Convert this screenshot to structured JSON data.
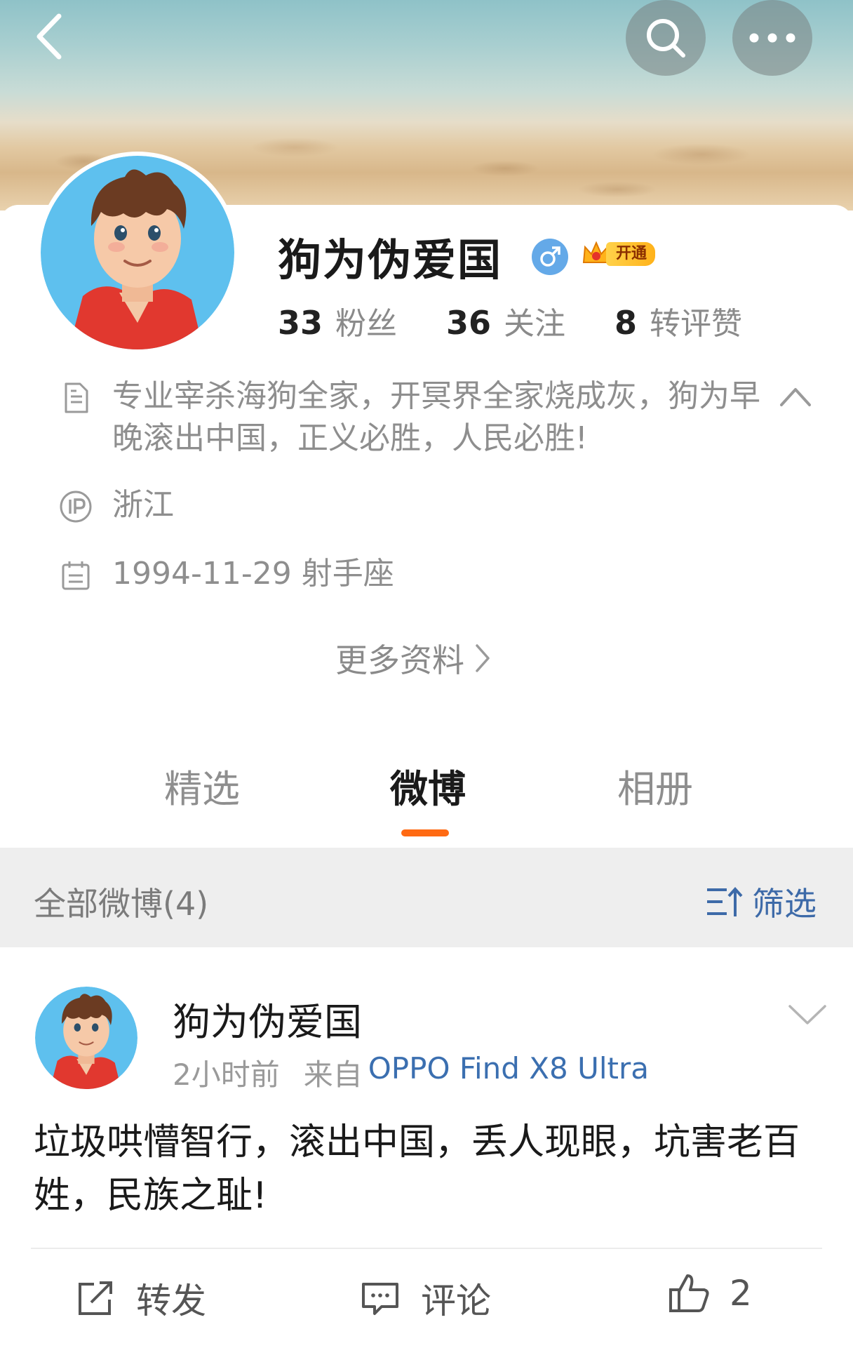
{
  "header": {
    "back_icon": "chevron-left-icon",
    "search_icon": "search-icon",
    "more_icon": "more-dots-icon"
  },
  "profile": {
    "nickname": "狗为伪爱国",
    "gender_icon": "male-icon",
    "vip_label": "开通",
    "stats": [
      {
        "num": "33",
        "label": "粉丝"
      },
      {
        "num": "36",
        "label": "关注"
      },
      {
        "num": "8",
        "label": "转评赞"
      }
    ],
    "bio": "专业宰杀海狗全家，开冥界全家烧成灰，狗为早晚滚出中国，正义必胜，人民必胜!",
    "ip": "浙江",
    "birthday": "1994-11-29 射手座",
    "more_info": "更多资料"
  },
  "tabs": [
    {
      "label": "精选"
    },
    {
      "label": "微博"
    },
    {
      "label": "相册"
    }
  ],
  "colors": {
    "accent": "#ff6a13",
    "link": "#3b6fb0"
  },
  "filter_bar": {
    "title": "全部微博(4)",
    "filter_label": "筛选"
  },
  "post": {
    "author": "狗为伪爱国",
    "time": "2小时前",
    "source_prefix": "来自",
    "device": "OPPO Find X8 Ultra",
    "text": "垃圾哄懵智行，滚出中国，丢人现眼，坑害老百姓，民族之耻!",
    "repost_label": "转发",
    "comment_label": "评论",
    "like_count": "2"
  }
}
